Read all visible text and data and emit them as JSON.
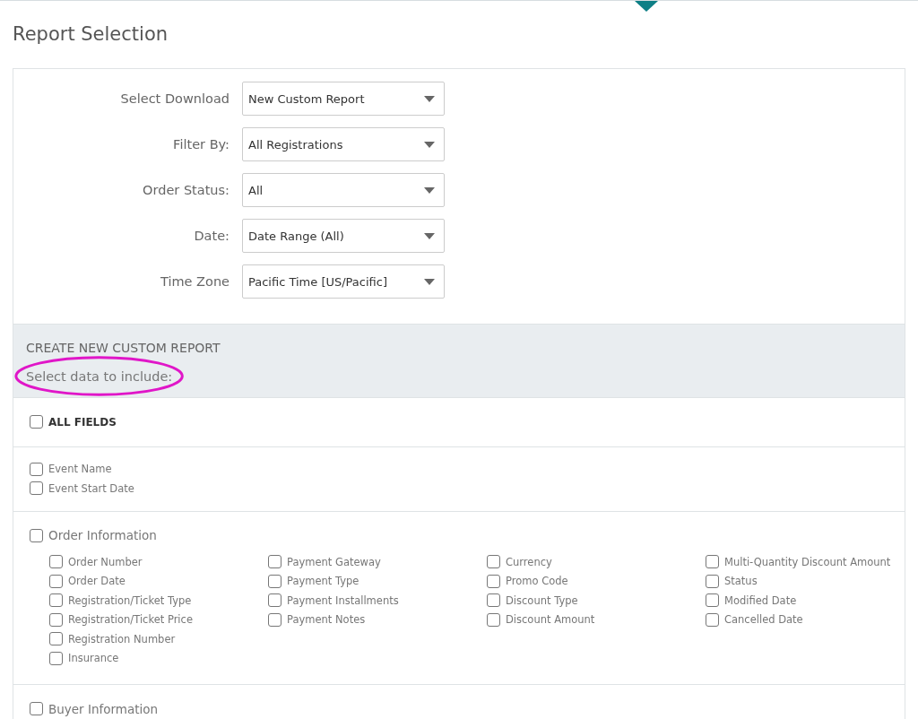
{
  "page_title": "Report Selection",
  "filters": [
    {
      "label": "Select Download",
      "value": "New Custom Report"
    },
    {
      "label": "Filter By:",
      "value": "All Registrations"
    },
    {
      "label": "Order Status:",
      "value": "All"
    },
    {
      "label": "Date:",
      "value": "Date Range (All)"
    },
    {
      "label": "Time Zone",
      "value": "Pacific Time [US/Pacific]"
    }
  ],
  "custom_report": {
    "heading": "CREATE NEW CUSTOM REPORT",
    "subheading": "Select data to include:"
  },
  "all_fields": {
    "label": "ALL FIELDS",
    "checked": false
  },
  "event_fields": [
    {
      "label": "Event Name",
      "checked": false
    },
    {
      "label": "Event Start Date",
      "checked": false
    }
  ],
  "groups": [
    {
      "label": "Order Information",
      "checked": false,
      "columns": [
        [
          {
            "label": "Order Number",
            "checked": false
          },
          {
            "label": "Order Date",
            "checked": false
          },
          {
            "label": "Registration/Ticket Type",
            "checked": false
          },
          {
            "label": "Registration/Ticket Price",
            "checked": false
          },
          {
            "label": "Registration Number",
            "checked": false
          },
          {
            "label": "Insurance",
            "checked": false
          }
        ],
        [
          {
            "label": "Payment Gateway",
            "checked": false
          },
          {
            "label": "Payment Type",
            "checked": false
          },
          {
            "label": "Payment Installments",
            "checked": false
          },
          {
            "label": "Payment Notes",
            "checked": false
          }
        ],
        [
          {
            "label": "Currency",
            "checked": false
          },
          {
            "label": "Promo Code",
            "checked": false
          },
          {
            "label": "Discount Type",
            "checked": false
          },
          {
            "label": "Discount Amount",
            "checked": false
          }
        ],
        [
          {
            "label": "Multi-Quantity Discount Amount",
            "checked": false
          },
          {
            "label": "Status",
            "checked": false
          },
          {
            "label": "Modified Date",
            "checked": false
          },
          {
            "label": "Cancelled Date",
            "checked": false
          }
        ]
      ]
    },
    {
      "label": "Buyer Information",
      "checked": false
    }
  ]
}
